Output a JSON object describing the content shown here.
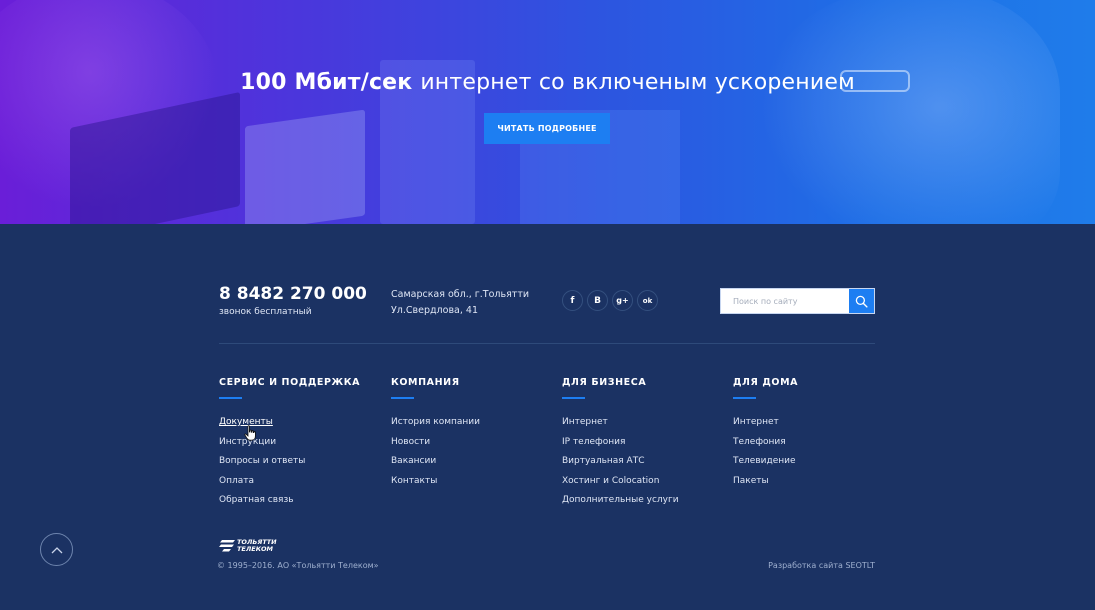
{
  "hero": {
    "title_strong": "100 Мбит/сек",
    "title_rest": "интернет со включеным ускорением",
    "button_label": "ЧИТАТЬ ПОДРОБНЕЕ"
  },
  "contacts": {
    "phone": "8 8482 270 000",
    "phone_note": "звонок бесплатный",
    "address_line1": "Самарская обл., г.Тольятти",
    "address_line2": "Ул.Свердлова, 41"
  },
  "social": [
    {
      "icon": "facebook-icon",
      "glyph": "f"
    },
    {
      "icon": "vk-icon",
      "glyph": "B"
    },
    {
      "icon": "google-plus-icon",
      "glyph": "g+"
    },
    {
      "icon": "odnoklassniki-icon",
      "glyph": "ok"
    }
  ],
  "search": {
    "placeholder": "Поиск по сайту",
    "value": ""
  },
  "columns": [
    {
      "title": "СЕРВИС И ПОДДЕРЖКА",
      "items": [
        "Документы",
        "Инструкции",
        "Вопросы и ответы",
        "Оплата",
        "Обратная связь"
      ]
    },
    {
      "title": "КОМПАНИЯ",
      "items": [
        "История компании",
        "Новости",
        "Вакансии",
        "Контакты"
      ]
    },
    {
      "title": "ДЛЯ БИЗНЕСА",
      "items": [
        "Интернет",
        "IP телефония",
        "Виртуальная АТС",
        "Хостинг и Colocation",
        "Дополнительные услуги"
      ]
    },
    {
      "title": "ДЛЯ ДОМА",
      "items": [
        "Интернет",
        "Телефония",
        "Телевидение",
        "Пакеты"
      ]
    }
  ],
  "footer": {
    "logo_line1": "ТОЛЬЯТТИ",
    "logo_line2": "ТЕЛЕКОМ",
    "copyright": "© 1995–2016. АО «Тольятти Телеком»",
    "developer": "Разработка сайта SEOTLT"
  },
  "colors": {
    "accent": "#1d7ef2",
    "footer_bg": "#1b3263"
  }
}
